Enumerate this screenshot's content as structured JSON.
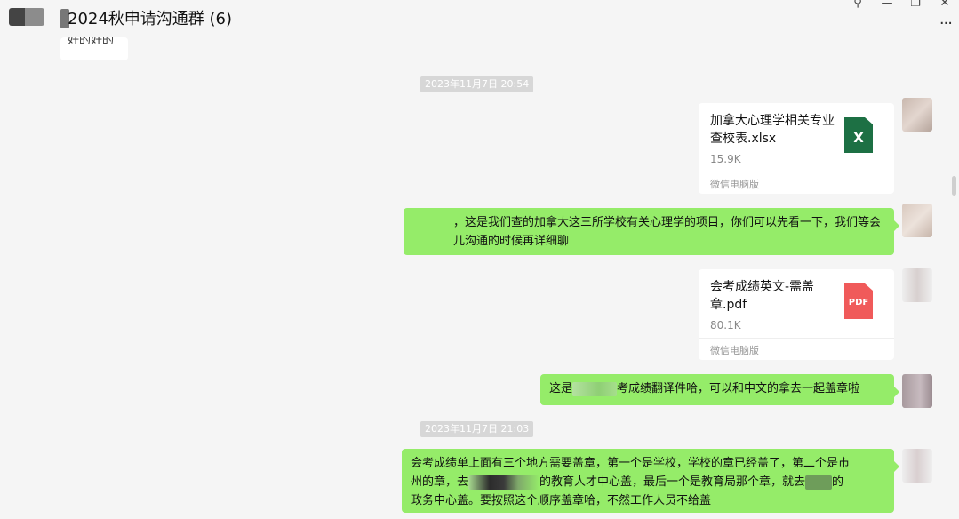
{
  "window": {
    "title": "2024秋申请沟通群 (6)",
    "buttons": {
      "pin": "⚲",
      "minimize": "—",
      "maximize": "❐",
      "close": "✕"
    },
    "more_icon": "···"
  },
  "chat": {
    "partial_message": "好的好的",
    "timestamps": [
      "2023年11月7日 20:54",
      "2023年11月7日 21:03"
    ],
    "messages": [
      {
        "type": "file",
        "name": "加拿大心理学相关专业查校表.xlsx",
        "size": "15.9K",
        "source": "微信电脑版",
        "icon": "excel-icon"
      },
      {
        "type": "text",
        "text": "，这是我们查的加拿大这三所学校有关心理学的项目，你们可以先看一下，我们等会儿沟通的时候再详细聊"
      },
      {
        "type": "file",
        "name": "会考成绩英文-需盖章.pdf",
        "size": "80.1K",
        "source": "微信电脑版",
        "icon": "pdf-icon"
      },
      {
        "type": "text",
        "text_a": "这是",
        "text_b": "考成绩翻译件哈，可以和中文的拿去一起盖章啦"
      },
      {
        "type": "text",
        "line1": "会考成绩单上面有三个地方需要盖章，第一个是学校，学校的章已经盖了，第二个是市",
        "line2_a": "州的章，去",
        "line2_b": "的教育人才中心盖，最后一个是教育局那个章，就去",
        "line2_c": "的",
        "line3": "政务中心盖。要按照这个顺序盖章哈，不然工作人员不给盖"
      }
    ]
  },
  "colors": {
    "bubble_green": "#95ec69",
    "background": "#f5f5f5",
    "excel": "#1d7044",
    "pdf": "#f05a5a"
  }
}
